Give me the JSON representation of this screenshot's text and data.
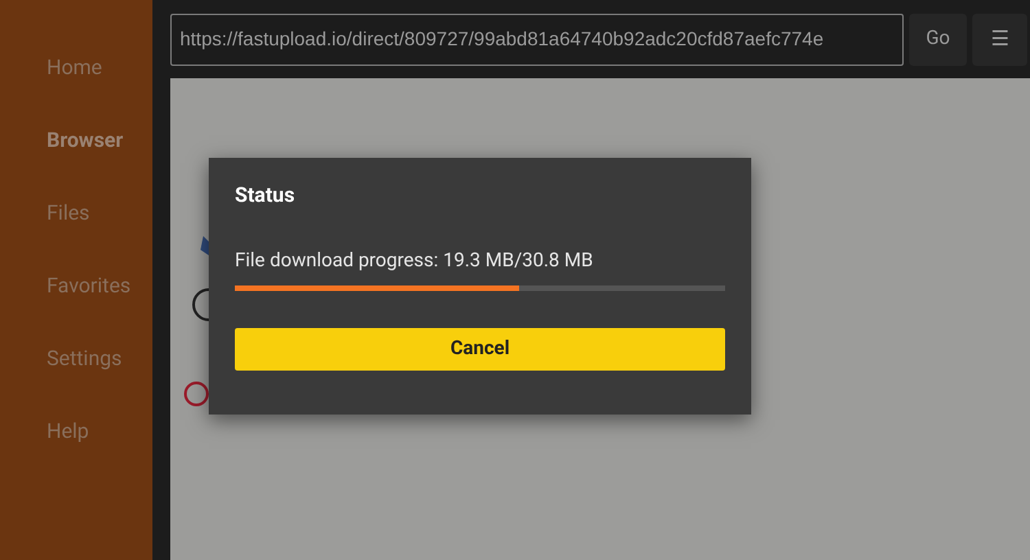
{
  "sidebar": {
    "items": [
      {
        "label": "Home",
        "selected": false
      },
      {
        "label": "Browser",
        "selected": true
      },
      {
        "label": "Files",
        "selected": false
      },
      {
        "label": "Favorites",
        "selected": false
      },
      {
        "label": "Settings",
        "selected": false
      },
      {
        "label": "Help",
        "selected": false
      }
    ]
  },
  "toolbar": {
    "url": "https://fastupload.io/direct/809727/99abd81a64740b92adc20cfd87aefc774e",
    "go": "Go",
    "menu": "☰"
  },
  "dialog": {
    "title": "Status",
    "message": "File download progress: 19.3 MB/30.8 MB",
    "level": 0.58,
    "button": "Cancel"
  }
}
